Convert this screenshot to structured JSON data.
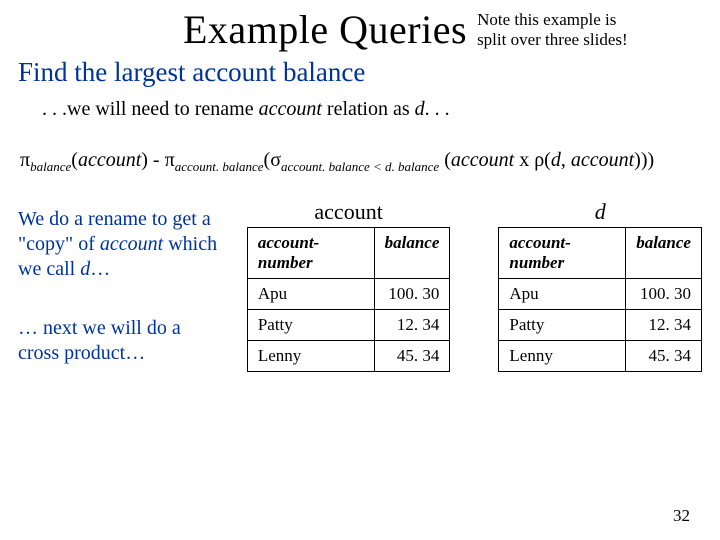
{
  "title": "Example Queries",
  "note_line1": "Note this example is",
  "note_line2": "split over three slides!",
  "subtitle": "Find the largest account balance",
  "rename_pre": ". . .we will need to rename ",
  "rename_mid": "account",
  "rename_post": " relation as ",
  "rename_d": "d",
  "rename_end": ". . .",
  "formula": {
    "pi": "π",
    "sub_balance": "balance",
    "sub_acct_bal": "account. balance",
    "sigma": "σ",
    "sub_cond": "account. balance < d. balance",
    "rho": "ρ",
    "account": "account",
    "d": "d",
    "x": "x",
    "open1": "(",
    "close1": ")",
    "minus": " - ",
    "open_rho": "(",
    "comma": ", ",
    "close_all": ")))"
  },
  "left": {
    "p1a": "We do a rename to get a \"copy\" of ",
    "p1b": "account",
    "p1c": " which we call ",
    "p1d": "d",
    "p1e": "…",
    "p2": "… next we will do a cross product…"
  },
  "tables": {
    "t1": {
      "caption": "account",
      "h1": "account-number",
      "h2": "balance",
      "rows": [
        {
          "a": "Apu",
          "b": "100. 30"
        },
        {
          "a": "Patty",
          "b": "12. 34"
        },
        {
          "a": "Lenny",
          "b": "45. 34"
        }
      ]
    },
    "t2": {
      "caption": "d",
      "h1": "account-number",
      "h2": "balance",
      "rows": [
        {
          "a": "Apu",
          "b": "100. 30"
        },
        {
          "a": "Patty",
          "b": "12. 34"
        },
        {
          "a": "Lenny",
          "b": "45. 34"
        }
      ]
    }
  },
  "slide_number": "32"
}
